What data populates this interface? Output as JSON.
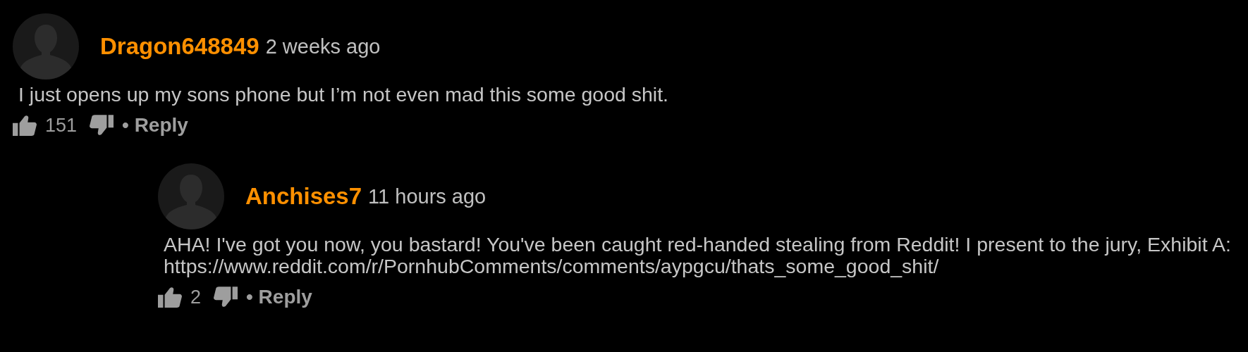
{
  "comments": [
    {
      "author": "Dragon648849",
      "time": "2 weeks ago",
      "text": "I just opens up my sons phone but I’m not even mad this some good shit.",
      "likes": "151",
      "reply": "• Reply",
      "children": [
        {
          "author": "Anchises7",
          "time": "11 hours ago",
          "text": "AHA! I've got you now, you bastard! You've been caught red-handed stealing from Reddit! I present to the jury, Exhibit A: https://www.reddit.com/r/PornhubComments/comments/aypgcu/thats_some_good_shit/",
          "likes": "2",
          "reply": "• Reply"
        }
      ]
    }
  ]
}
